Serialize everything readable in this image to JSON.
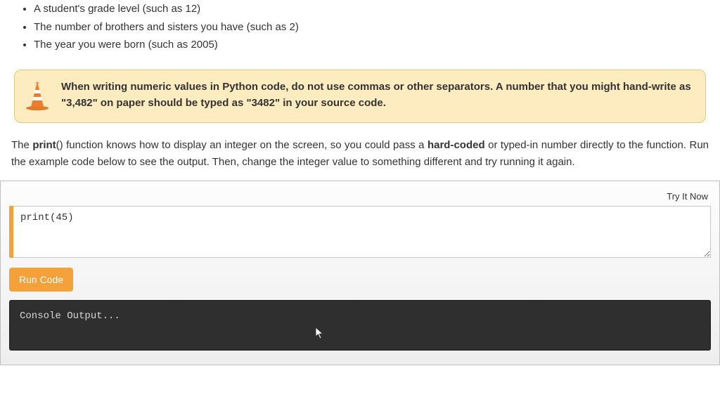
{
  "bullets": [
    "A student's grade level (such as 12)",
    "The number of brothers and sisters you have (such as 2)",
    "The year you were born (such as 2005)"
  ],
  "callout": {
    "text": "When writing numeric values in Python code, do not use commas or other separators. A number that you might hand-write as \"3,482\" on paper should be typed as \"3482\" in your source code."
  },
  "paragraph": {
    "pre": "The ",
    "bold1": "print",
    "mid1": "() function knows how to display an integer on the screen, so you could pass a ",
    "bold2": "hard-coded",
    "mid2": " or typed-in number directly to the function. Run the example code below to see the output. Then, change the integer value to something different and try running it again."
  },
  "editor": {
    "try_label": "Try It Now",
    "code": "print(45)",
    "run_label": "Run Code",
    "console_placeholder": "Console Output..."
  }
}
